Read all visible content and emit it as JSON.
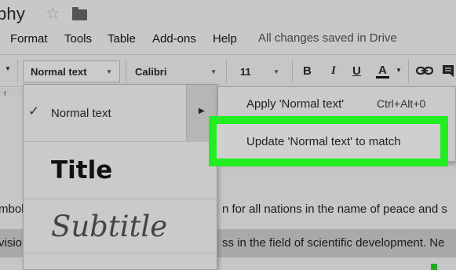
{
  "title_bar": {
    "doc_title": "phy",
    "star_icon": "star-outline-icon",
    "folder_icon": "folder-icon"
  },
  "menubar": {
    "items": [
      "Format",
      "Tools",
      "Table",
      "Add-ons",
      "Help"
    ],
    "save_status": "All changes saved in Drive"
  },
  "toolbar": {
    "style_value": "Normal text",
    "font_value": "Calibri",
    "size_value": "11",
    "bold_label": "B",
    "italic_label": "I",
    "underline_label": "U",
    "text_color_label": "A",
    "link_icon": "link-icon",
    "comment_icon": "comment-icon"
  },
  "style_menu": {
    "normal_label": "Normal text",
    "title_label": "Title",
    "subtitle_label": "Subtitle"
  },
  "submenu": {
    "apply_label": "Apply 'Normal text'",
    "apply_shortcut": "Ctrl+Alt+0",
    "update_label": "Update 'Normal text' to match"
  },
  "document": {
    "line1_left": "mbol",
    "line1_right": "n for all nations in the name of peace and s",
    "line2_left": "visio",
    "line2_right": "ss in the field of scientific development. Ne"
  },
  "colors": {
    "highlight": "#22ee22"
  }
}
